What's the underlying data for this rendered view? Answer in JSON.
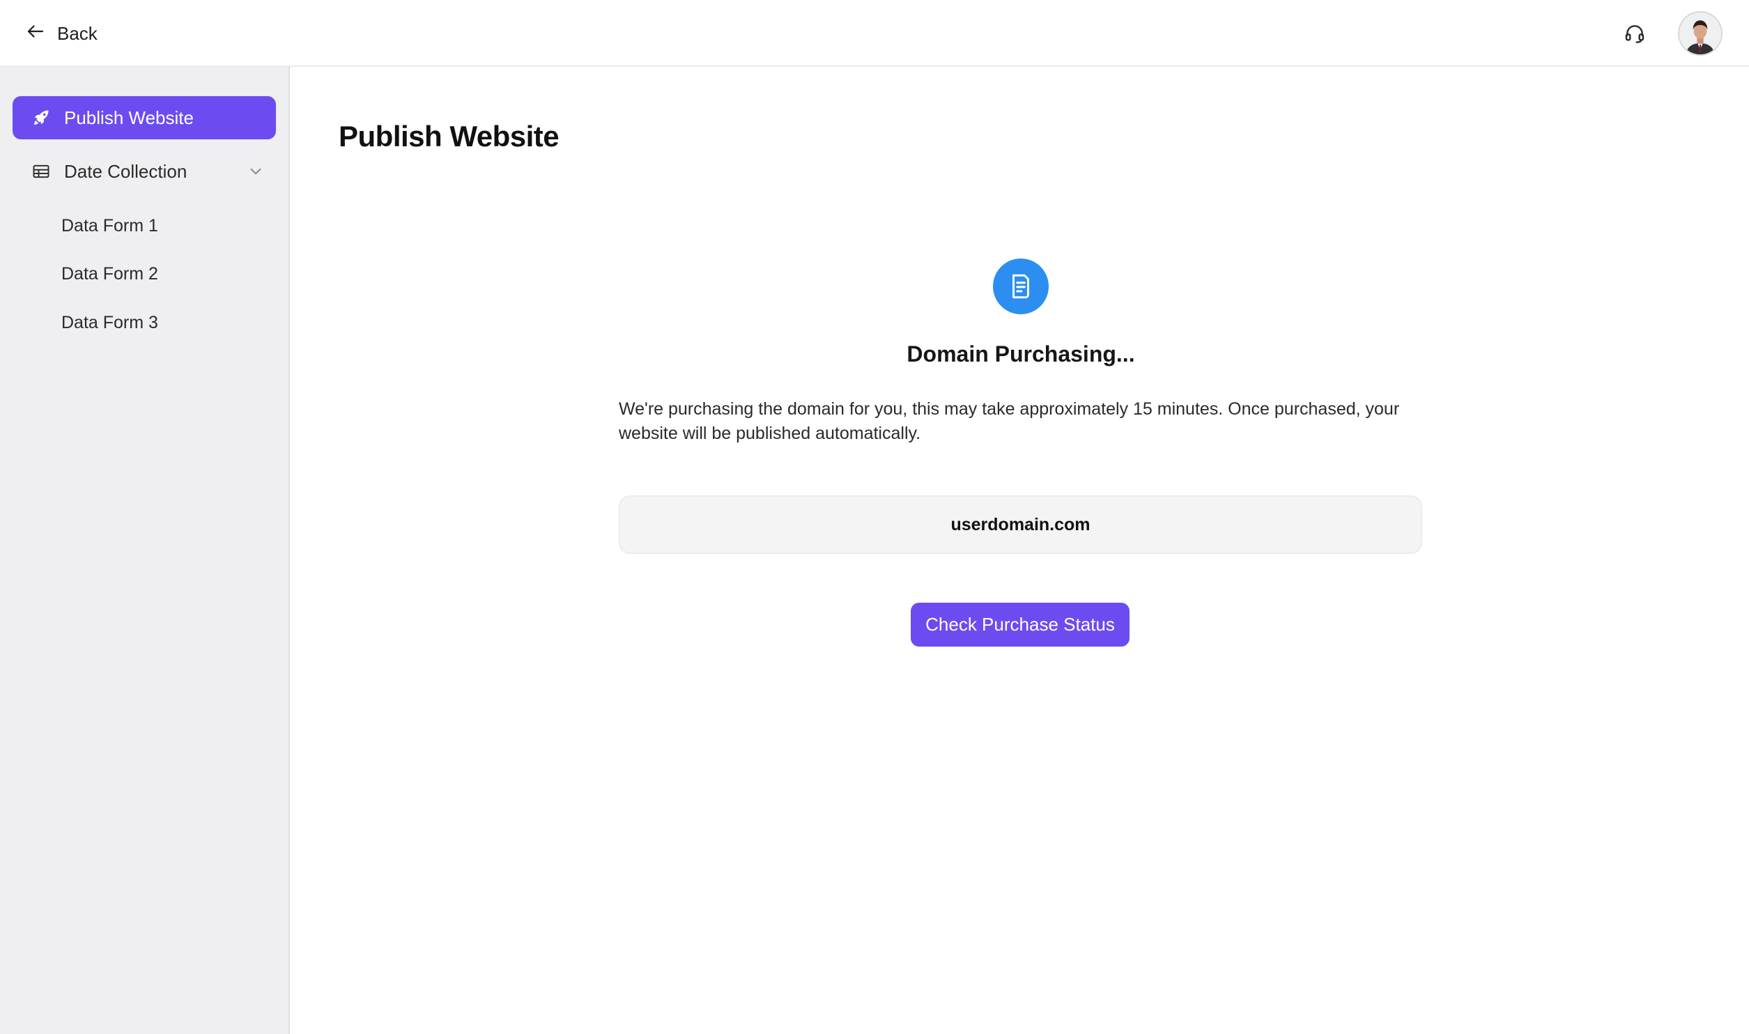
{
  "topbar": {
    "back_label": "Back",
    "support_icon": "headset-icon",
    "avatar_icon": "user-avatar"
  },
  "sidebar": {
    "items": [
      {
        "label": "Publish Website",
        "icon": "rocket-icon",
        "active": true
      },
      {
        "label": "Date Collection",
        "icon": "table-icon",
        "expanded": true,
        "children": [
          {
            "label": "Data Form 1"
          },
          {
            "label": "Data Form 2"
          },
          {
            "label": "Data Form 3"
          }
        ]
      }
    ]
  },
  "main": {
    "title": "Publish Website",
    "status": {
      "icon": "document-icon",
      "title": "Domain Purchasing...",
      "description": "We're purchasing the domain for you, this may take approximately 15 minutes. Once purchased, your website will be published automatically.",
      "domain": "userdomain.com"
    },
    "check_button_label": "Check Purchase Status"
  },
  "colors": {
    "accent": "#6c4cf1",
    "status_icon_bg": "#2b8ef0",
    "sidebar_bg": "#efeff1"
  }
}
